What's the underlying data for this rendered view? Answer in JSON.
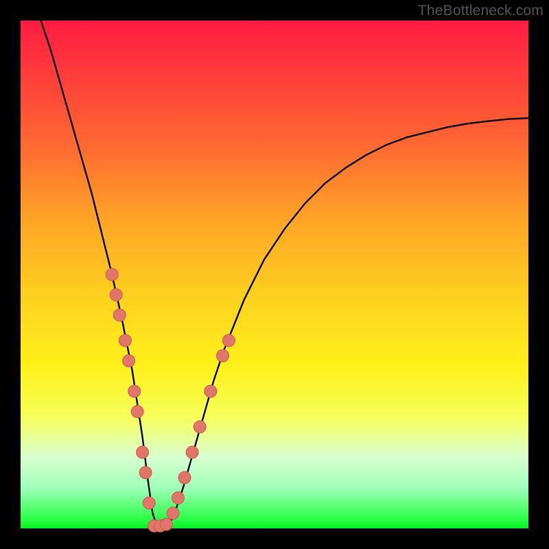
{
  "watermark": "TheBottleneck.com",
  "chart_data": {
    "type": "line",
    "title": "",
    "xlabel": "",
    "ylabel": "",
    "xlim": [
      0,
      100
    ],
    "ylim": [
      0,
      100
    ],
    "series": [
      {
        "name": "curve",
        "x": [
          4,
          6,
          8,
          10,
          12,
          14,
          16,
          18,
          20,
          22,
          24,
          25,
          26,
          27,
          28,
          30,
          32,
          34,
          36,
          38,
          40,
          44,
          48,
          52,
          56,
          60,
          64,
          68,
          72,
          76,
          80,
          84,
          88,
          92,
          96,
          100
        ],
        "values": [
          100,
          94,
          87,
          80,
          73,
          66,
          58,
          50,
          41,
          31,
          18,
          10,
          3,
          0,
          0,
          2,
          8,
          15,
          22,
          29,
          35,
          45,
          53,
          59,
          64,
          68,
          71,
          73.5,
          75.5,
          77,
          78,
          79,
          79.7,
          80.2,
          80.6,
          80.8
        ]
      }
    ],
    "markers": [
      {
        "x": 18.0,
        "y": 50
      },
      {
        "x": 18.8,
        "y": 46
      },
      {
        "x": 19.5,
        "y": 42
      },
      {
        "x": 20.6,
        "y": 37
      },
      {
        "x": 21.3,
        "y": 33
      },
      {
        "x": 22.4,
        "y": 27
      },
      {
        "x": 23.0,
        "y": 23
      },
      {
        "x": 24.0,
        "y": 15
      },
      {
        "x": 24.6,
        "y": 11
      },
      {
        "x": 25.3,
        "y": 5
      },
      {
        "x": 26.3,
        "y": 0.5
      },
      {
        "x": 27.5,
        "y": 0.5
      },
      {
        "x": 28.7,
        "y": 0.8
      },
      {
        "x": 30.0,
        "y": 3
      },
      {
        "x": 31.0,
        "y": 6
      },
      {
        "x": 32.3,
        "y": 10
      },
      {
        "x": 33.8,
        "y": 15
      },
      {
        "x": 35.3,
        "y": 20
      },
      {
        "x": 37.4,
        "y": 27
      },
      {
        "x": 39.8,
        "y": 34
      },
      {
        "x": 41.0,
        "y": 37
      }
    ],
    "colors": {
      "curve": "#000000",
      "marker_fill": "#e0766a",
      "marker_stroke": "#c95b52"
    }
  }
}
